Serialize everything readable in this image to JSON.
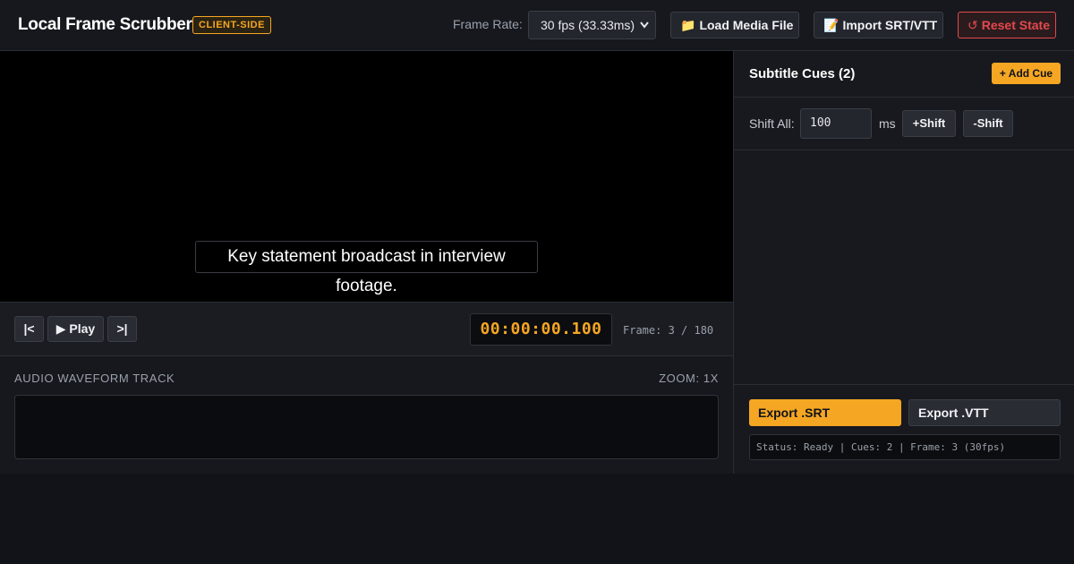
{
  "header": {
    "title": "Local Frame Scrubber",
    "badge": "CLIENT-SIDE",
    "frame_rate_label": "Frame Rate:",
    "frame_rate_value": "30 fps (33.33ms)",
    "load_label": "Load Media File",
    "load_icon": "folder-icon",
    "import_label": "Import SRT/VTT",
    "import_icon": "memo-icon",
    "reset_label": "Reset State",
    "reset_icon": "reset-arrow-icon"
  },
  "video": {
    "subtitle_text": "Key statement broadcast in interview footage."
  },
  "transport": {
    "first_label": "|<",
    "play_label": "▶ Play",
    "last_label": ">|",
    "timecode": "00:00:00.100",
    "frame_readout": "Frame: 3 / 180"
  },
  "waveform": {
    "title": "AUDIO WAVEFORM TRACK",
    "zoom": "ZOOM: 1X"
  },
  "sidebar": {
    "title": "Subtitle Cues (2)",
    "add_cue_label": "+ Add Cue",
    "shift_label": "Shift All:",
    "shift_value": "100",
    "shift_unit": "ms",
    "shift_plus_label": "+Shift",
    "shift_minus_label": "-Shift",
    "export_srt_label": "Export .SRT",
    "export_vtt_label": "Export .VTT",
    "status": "Status: Ready | Cues: 2 | Frame: 3 (30fps)"
  },
  "colors": {
    "accent": "#f5a623",
    "danger": "#e5484d",
    "background": "#111318"
  }
}
